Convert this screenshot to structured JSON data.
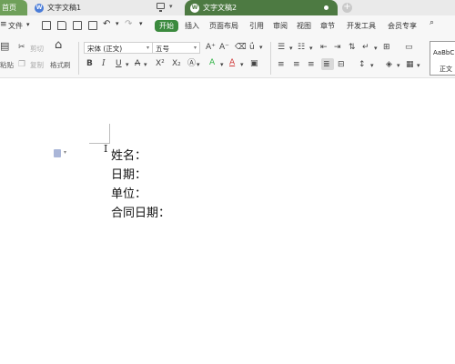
{
  "tabs": {
    "home": "首页",
    "doc1": "文字文稿1",
    "doc2": "文字文稿2",
    "new_tab": "+"
  },
  "menubar": {
    "file": "文件",
    "file_caret": "▾",
    "items": [
      "开始",
      "插入",
      "页面布局",
      "引用",
      "审阅",
      "视图",
      "章节",
      "开发工具",
      "会员专享"
    ]
  },
  "ribbon": {
    "cut": "剪切",
    "paste": "粘贴",
    "copy": "复制",
    "format_painter": "格式刷",
    "font_name": "宋体 (正文)",
    "font_size": "五号",
    "bold": "B",
    "italic": "I",
    "underline": "U",
    "strike": "A",
    "superscript": "X²",
    "subscript": "X₂",
    "font_color": "A",
    "highlight": "A",
    "grow": "A⁺",
    "shrink": "A⁻",
    "style_preview_1": "AaBbC",
    "style_preview_2": "正文"
  },
  "document": {
    "lines": [
      "姓名：",
      "日期：",
      "单位：",
      "合同日期："
    ]
  },
  "colors": {
    "accent_green": "#3b8a3e",
    "active_tab": "#4d7a42",
    "home_tab": "#6fa05a",
    "highlight_green": "#2fb344",
    "font_red": "#d03a3a"
  }
}
